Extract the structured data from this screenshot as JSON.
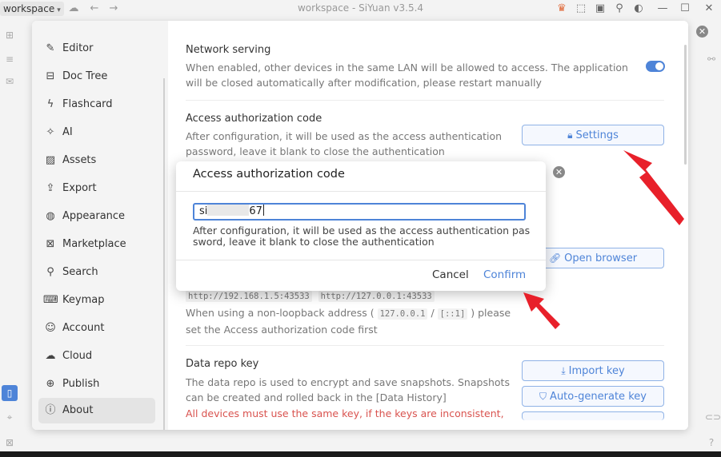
{
  "titlebar": {
    "workspace_label": "workspace",
    "window_title": "workspace - SiYuan v3.5.4"
  },
  "colors": {
    "accent": "#4e84d8",
    "warning": "#d9534f",
    "annotation_arrow": "#e8202a"
  },
  "sidebar": {
    "items": [
      {
        "label": "Editor",
        "icon": "pencil-icon"
      },
      {
        "label": "Doc Tree",
        "icon": "doc-tree-icon"
      },
      {
        "label": "Flashcard",
        "icon": "flashcard-icon"
      },
      {
        "label": "AI",
        "icon": "ai-sparkle-icon"
      },
      {
        "label": "Assets",
        "icon": "image-icon"
      },
      {
        "label": "Export",
        "icon": "export-icon"
      },
      {
        "label": "Appearance",
        "icon": "palette-icon"
      },
      {
        "label": "Marketplace",
        "icon": "marketplace-icon"
      },
      {
        "label": "Search",
        "icon": "search-icon"
      },
      {
        "label": "Keymap",
        "icon": "keyboard-icon"
      },
      {
        "label": "Account",
        "icon": "user-icon"
      },
      {
        "label": "Cloud",
        "icon": "cloud-icon"
      },
      {
        "label": "Publish",
        "icon": "globe-icon"
      },
      {
        "label": "About",
        "icon": "info-icon",
        "active": true
      }
    ]
  },
  "content": {
    "network": {
      "title": "Network serving",
      "desc": "When enabled, other devices in the same LAN will be allowed to access. The application will be closed automatically after modification, please restart manually",
      "enabled": true
    },
    "auth": {
      "title": "Access authorization code",
      "desc": "After configuration, it will be used as the access authentication password, leave it blank to close the authentication",
      "button": "Settings"
    },
    "open_browser_button": "Open browser",
    "addresses": {
      "addr1": "http://192.168.1.5:43533",
      "addr2": "http://127.0.0.1:43533",
      "note_pre": "When using a non-loopback address (",
      "loop1": "127.0.0.1",
      "slash": " / ",
      "loop2": "[::1]",
      "note_post": ") please set the Access authorization code first"
    },
    "repo": {
      "title": "Data repo key",
      "desc": "The data repo is used to encrypt and save snapshots. Snapshots can be created and rolled back in the [Data History]",
      "warn": "All devices must use the same key, if the keys are inconsistent,",
      "import_button": "Import key",
      "autogen_button": "Auto-generate key"
    }
  },
  "dialog": {
    "title": "Access authorization code",
    "input_prefix": "si",
    "input_suffix": "67",
    "desc": "After configuration, it will be used as the access authentication password, leave it blank to close the authentication",
    "cancel": "Cancel",
    "confirm": "Confirm"
  }
}
